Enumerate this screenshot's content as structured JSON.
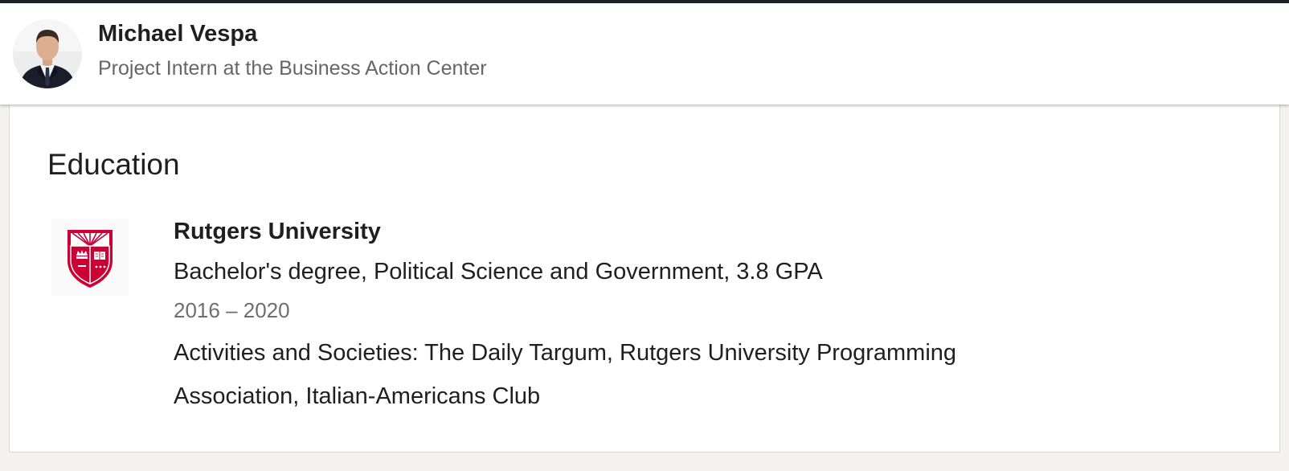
{
  "profile": {
    "name": "Michael Vespa",
    "headline": "Project Intern at the Business Action Center",
    "avatar_icon": "profile-photo"
  },
  "education": {
    "section_title": "Education",
    "entries": [
      {
        "logo_icon": "rutgers-shield-logo",
        "logo_color": "#cc0033",
        "school": "Rutgers University",
        "degree": "Bachelor's degree, Political Science and Government, 3.8 GPA",
        "dates": "2016 – 2020",
        "activities": "Activities and Societies: The Daily Targum, Rutgers University Programming Association, Italian-Americans Club"
      }
    ]
  }
}
